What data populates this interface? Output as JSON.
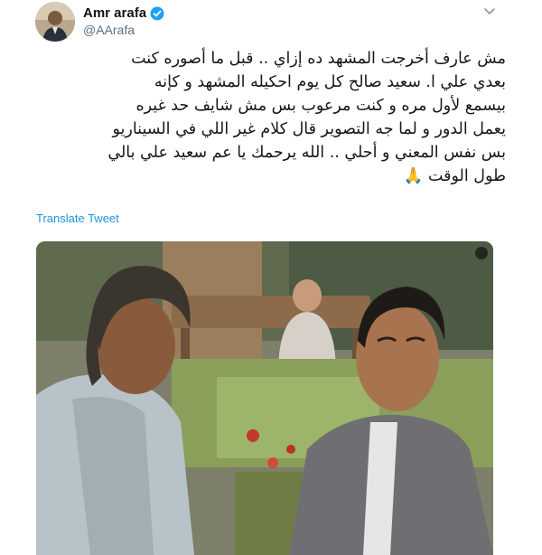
{
  "author": {
    "name": "Amr arafa",
    "handle": "@AArafa",
    "verified": true,
    "verified_color": "#1da1f2"
  },
  "tweet": {
    "lines": [
      "مش عارف أخرجت المشهد ده إزاي .. قبل ما أصوره كنت",
      "بعدي علي ا. سعيد صالح كل يوم احكيله المشهد و كإنه",
      "بيسمع لأول مره و كنت مرعوب بس مش شايف حد غيره",
      "يعمل الدور و لما جه التصوير قال كلام غير اللي في السيناريو",
      "بس نفس المعني و أحلي .. الله يرحمك يا عم سعيد علي بالي",
      "طول الوقت 🙏"
    ],
    "translate_label": "Translate Tweet"
  },
  "icons": {
    "menu": "chevron-down-icon",
    "verified": "verified-badge-icon",
    "media_action": "media-expand-icon"
  },
  "colors": {
    "link": "#1b95e0",
    "secondary_text": "#5b7083"
  }
}
